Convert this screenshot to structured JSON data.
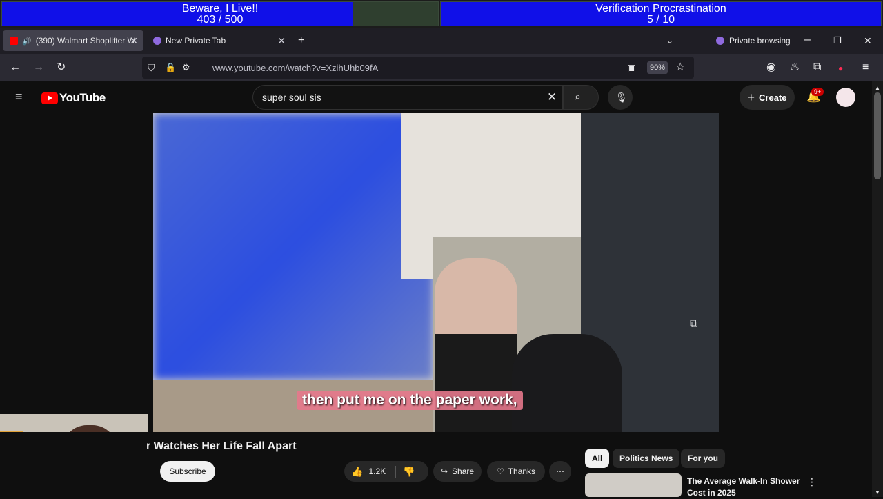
{
  "stream_goals": [
    {
      "title": "Beware, I Live!!",
      "progress_text": "403 / 500",
      "progress": 0.806
    },
    {
      "title": "Verification Procrastination",
      "progress_text": "5 / 10",
      "progress": 1.0
    }
  ],
  "browser": {
    "tabs": [
      {
        "label": "(390) Walmart Shoplifter W",
        "active": true
      },
      {
        "label": "New Private Tab",
        "active": false
      }
    ],
    "private_label": "Private browsing",
    "url": "www.youtube.com/watch?v=XzihUhb09fA",
    "zoom": "90%"
  },
  "youtube": {
    "logo_text": "YouTube",
    "search_value": "super soul sis",
    "create_label": "Create",
    "notification_badge": "9+"
  },
  "video": {
    "subtitle": "then put me on the paper work,",
    "title": "r Watches Her Life Fall Apart",
    "subscribe_label": "Subscribe",
    "likes": "1.2K",
    "share_label": "Share",
    "thanks_label": "Thanks"
  },
  "chips": [
    "All",
    "Politics News",
    "For you"
  ],
  "recommendation": {
    "title_line1": "The Average Walk-In Shower",
    "title_line2": "Cost in 2025"
  },
  "colors": {
    "accent": "#1010e8",
    "yt_red": "#ff0000"
  }
}
